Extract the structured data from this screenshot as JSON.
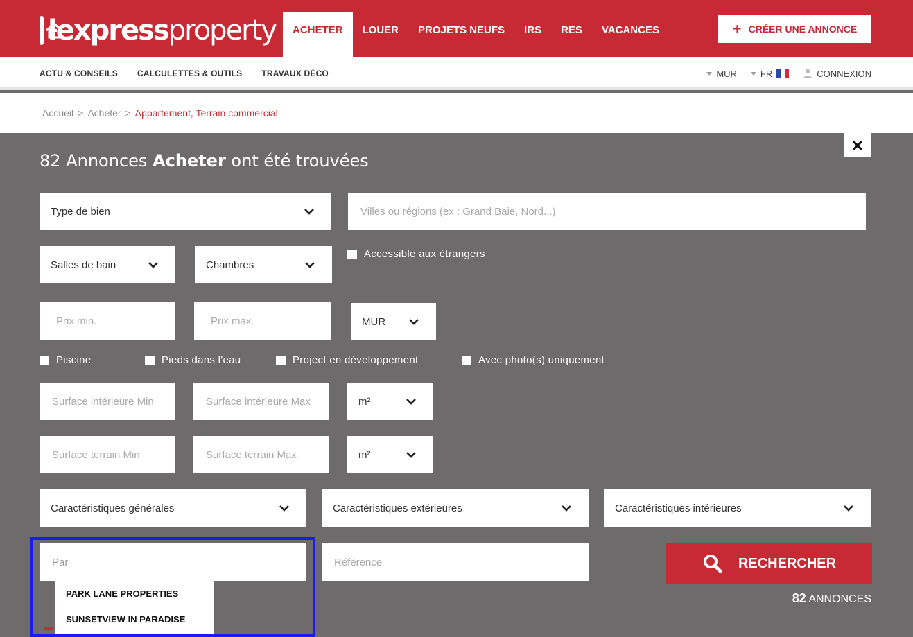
{
  "brand": {
    "logo_bold": "lexpress",
    "logo_light": "property"
  },
  "nav": [
    {
      "label": "ACHETER",
      "active": true
    },
    {
      "label": "LOUER",
      "active": false
    },
    {
      "label": "PROJETS NEUFS",
      "active": false
    },
    {
      "label": "IRS",
      "active": false
    },
    {
      "label": "RES",
      "active": false
    },
    {
      "label": "VACANCES",
      "active": false
    }
  ],
  "header": {
    "create_label": "CRÉER UNE ANNONCE"
  },
  "subnav": [
    {
      "label": "ACTU & CONSEILS"
    },
    {
      "label": "CALCULETTES & OUTILS"
    },
    {
      "label": "TRAVAUX DÉCO"
    }
  ],
  "utility": {
    "currency": "MUR",
    "language": "FR",
    "login": "CONNEXION"
  },
  "breadcrumb": {
    "home": "Accueil",
    "sep": ">",
    "section": "Acheter",
    "current": "Appartement, Terrain commercial"
  },
  "results": {
    "count": "82",
    "annonces_word": "Annonces",
    "mode": "Acheter",
    "suffix": "ont été trouvées",
    "footer_count": "82",
    "footer_word": "ANNONCES"
  },
  "form": {
    "type_de_bien": "Type de bien",
    "location_placeholder": "Villes ou régions (ex : Grand Baie, Nord...)",
    "bathrooms": "Salles de bain",
    "bedrooms": "Chambres",
    "foreigners": "Accessible aux étrangers",
    "price_min": "Prix min.",
    "price_max": "Prix max.",
    "price_currency": "MUR",
    "checks": [
      "Piscine",
      "Pieds dans l'eau",
      "Project en développement",
      "Avec photo(s) uniquement"
    ],
    "surface_int_min": "Surface intérieure Min",
    "surface_int_max": "Surface intérieure Max",
    "surface_int_unit": "m²",
    "surface_land_min": "Surface terrain Min",
    "surface_land_max": "Surface terrain Max",
    "surface_land_unit": "m²",
    "features_general": "Caractéristiques générales",
    "features_exterior": "Caractéristiques extérieures",
    "features_interior": "Caractéristiques intérieures",
    "agency_value": "Par",
    "reference_placeholder": "Référence",
    "search_label": "RECHERCHER"
  },
  "autocomplete": [
    {
      "label": "PARK LANE PROPERTIES"
    },
    {
      "label": "SUNSETVIEW IN PARADISE"
    }
  ],
  "icons": {
    "logo": "house-icon",
    "create": "plus-icon",
    "close": "close-icon",
    "select": "chevron-down-icon",
    "search": "search-icon",
    "user": "user-icon",
    "flag": "france-flag-icon"
  },
  "colors": {
    "brand_red": "#c72a35",
    "panel_grey": "#6d6b6c",
    "highlight_blue": "#1b1bf0"
  }
}
